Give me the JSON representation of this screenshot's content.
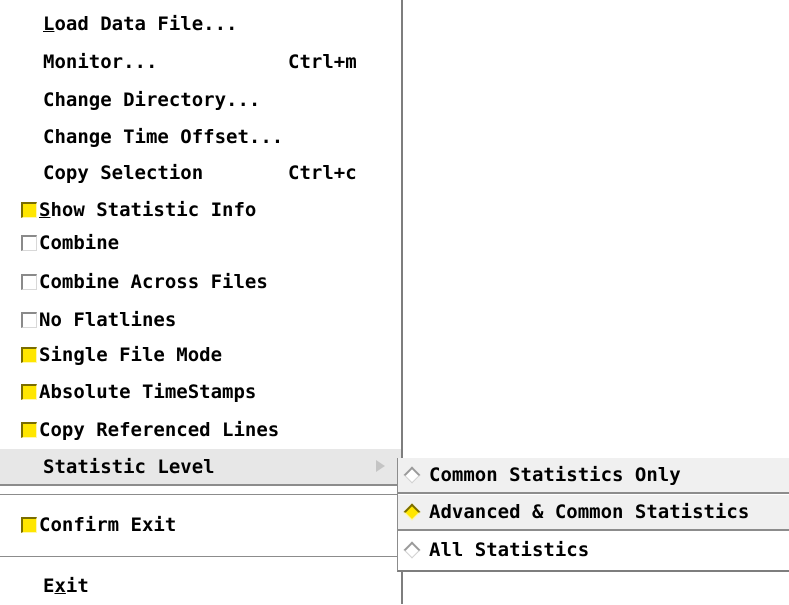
{
  "menu": {
    "items": [
      {
        "label": "Load Data File...",
        "mnemonic": "L",
        "accel": ""
      },
      {
        "label": "Monitor...",
        "accel": "Ctrl+m"
      },
      {
        "label": "Change Directory...",
        "accel": ""
      },
      {
        "label": "Change Time Offset...",
        "accel": ""
      },
      {
        "label": "Copy Selection",
        "accel": "Ctrl+c"
      }
    ],
    "toggles": [
      {
        "label": "Show Statistic Info",
        "mnemonic": "S",
        "checked": true
      },
      {
        "label": "Combine",
        "checked": false
      },
      {
        "label": "Combine Across Files",
        "checked": false
      },
      {
        "label": "No Flatlines",
        "checked": false
      },
      {
        "label": "Single File Mode",
        "checked": true
      },
      {
        "label": "Absolute TimeStamps",
        "checked": true
      },
      {
        "label": "Copy Referenced Lines",
        "checked": true
      }
    ],
    "cascade": {
      "label": "Statistic Level"
    },
    "confirm_exit": {
      "label": "Confirm Exit",
      "checked": true
    },
    "exit": {
      "label": "Exit",
      "mnemonic": "x"
    }
  },
  "submenu": {
    "options": [
      {
        "label": "Common Statistics Only",
        "selected": false
      },
      {
        "label": "Advanced & Common Statistics",
        "selected": true
      },
      {
        "label": "All Statistics",
        "selected": false
      }
    ]
  },
  "colors": {
    "checked_fill": "#ffe600",
    "highlight": "#e7e7e7",
    "bevel_dark": "#8c8c8c"
  }
}
